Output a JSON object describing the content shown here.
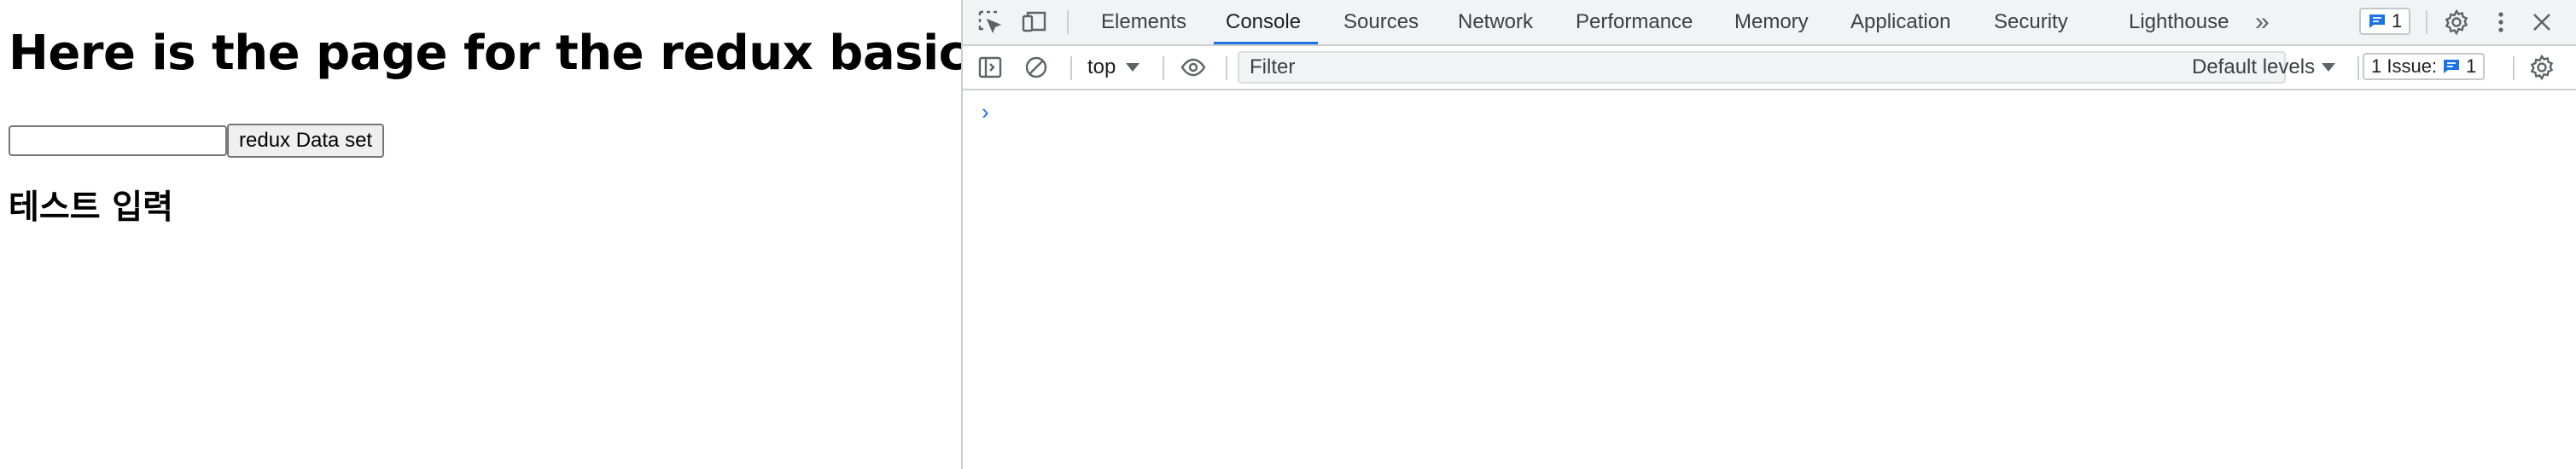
{
  "page": {
    "heading": "Here is the page for the redux basic test",
    "input_value": "",
    "button_label": "redux Data set",
    "subheading": "테스트 입력"
  },
  "devtools": {
    "tabs": [
      {
        "label": "Elements"
      },
      {
        "label": "Console",
        "active": true
      },
      {
        "label": "Sources"
      },
      {
        "label": "Network"
      },
      {
        "label": "Performance"
      },
      {
        "label": "Memory"
      },
      {
        "label": "Application"
      },
      {
        "label": "Security"
      },
      {
        "label": "Lighthouse"
      }
    ],
    "more_tabs": "»",
    "message_count": "1",
    "toolbar": {
      "context": "top",
      "filter_placeholder": "Filter",
      "levels": "Default levels",
      "issues_label": "1 Issue:",
      "issues_count": "1"
    },
    "prompt": "›"
  },
  "colors": {
    "accent": "#1a73e8",
    "toolbar_bg": "#f1f3f4",
    "border": "#cbcdd1"
  }
}
